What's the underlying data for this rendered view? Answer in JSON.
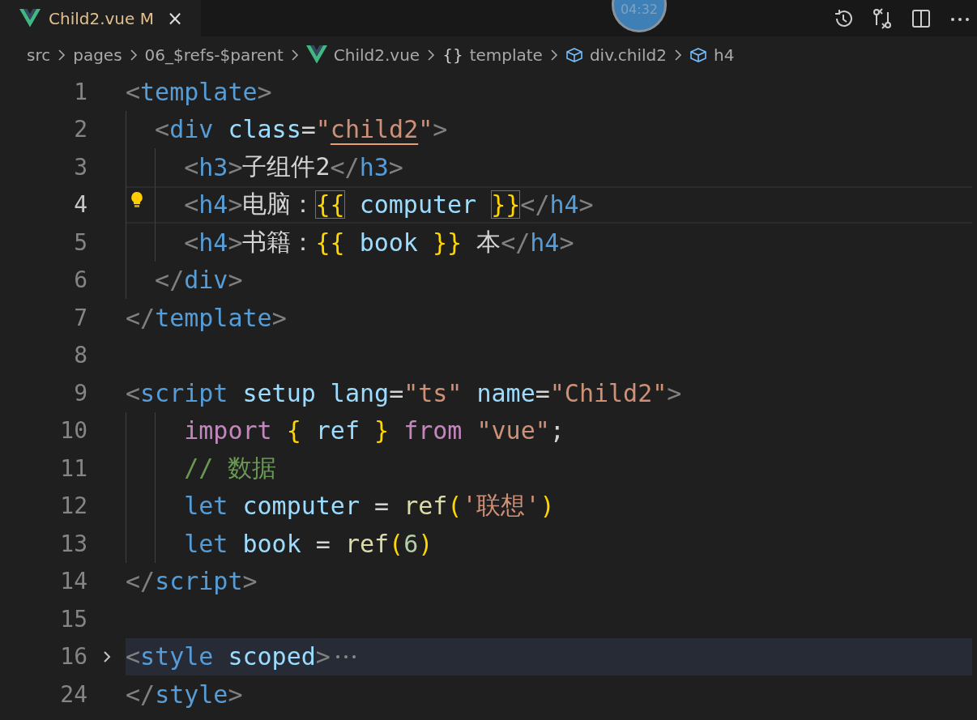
{
  "tab": {
    "title": "Child2.vue",
    "status": "M",
    "modified": true,
    "close": "×"
  },
  "timer": "04:32",
  "breadcrumbs": [
    {
      "label": "src",
      "kind": "folder"
    },
    {
      "label": "pages",
      "kind": "folder"
    },
    {
      "label": "06_$refs-$parent",
      "kind": "folder"
    },
    {
      "label": "Child2.vue",
      "kind": "file"
    },
    {
      "label": "template",
      "kind": "symbol",
      "glyph": "{}"
    },
    {
      "label": "div.child2",
      "kind": "element"
    },
    {
      "label": "h4",
      "kind": "element"
    }
  ],
  "lines": [
    {
      "number": "1",
      "current": false,
      "folded": false,
      "lightbulb": false,
      "tokens": [
        {
          "text": "<",
          "kind": "punct"
        },
        {
          "text": "template",
          "kind": "tag"
        },
        {
          "text": ">",
          "kind": "punct"
        }
      ]
    },
    {
      "number": "2",
      "current": false,
      "folded": false,
      "lightbulb": false,
      "tokens": [
        {
          "text": "  <",
          "kind": "punct"
        },
        {
          "text": "div",
          "kind": "tag"
        },
        {
          "text": " class",
          "kind": "attr"
        },
        {
          "text": "=",
          "kind": "text"
        },
        {
          "text": "\"",
          "kind": "str"
        },
        {
          "text": "child2",
          "kind": "warn"
        },
        {
          "text": "\"",
          "kind": "str"
        },
        {
          "text": ">",
          "kind": "punct"
        }
      ]
    },
    {
      "number": "3",
      "current": false,
      "folded": false,
      "lightbulb": false,
      "tokens": [
        {
          "text": "    <",
          "kind": "punct"
        },
        {
          "text": "h3",
          "kind": "tag"
        },
        {
          "text": ">",
          "kind": "punct"
        },
        {
          "text": "子组件2",
          "kind": "text"
        },
        {
          "text": "</",
          "kind": "punct"
        },
        {
          "text": "h3",
          "kind": "tag"
        },
        {
          "text": ">",
          "kind": "punct"
        }
      ]
    },
    {
      "number": "4",
      "current": true,
      "folded": false,
      "lightbulb": true,
      "tokens": [
        {
          "text": "    <",
          "kind": "punct"
        },
        {
          "text": "h4",
          "kind": "tag"
        },
        {
          "text": ">",
          "kind": "punct"
        },
        {
          "text": "电脑：",
          "kind": "text"
        },
        {
          "text": "{{",
          "kind": "match"
        },
        {
          "text": " computer ",
          "kind": "var"
        },
        {
          "text": "}}",
          "kind": "match"
        },
        {
          "text": "</",
          "kind": "punct"
        },
        {
          "text": "h4",
          "kind": "tag"
        },
        {
          "text": ">",
          "kind": "punct"
        }
      ]
    },
    {
      "number": "5",
      "current": false,
      "folded": false,
      "lightbulb": false,
      "tokens": [
        {
          "text": "    <",
          "kind": "punct"
        },
        {
          "text": "h4",
          "kind": "tag"
        },
        {
          "text": ">",
          "kind": "punct"
        },
        {
          "text": "书籍：",
          "kind": "text"
        },
        {
          "text": "{{",
          "kind": "brace"
        },
        {
          "text": " book ",
          "kind": "var"
        },
        {
          "text": "}}",
          "kind": "brace"
        },
        {
          "text": " 本",
          "kind": "text"
        },
        {
          "text": "</",
          "kind": "punct"
        },
        {
          "text": "h4",
          "kind": "tag"
        },
        {
          "text": ">",
          "kind": "punct"
        }
      ]
    },
    {
      "number": "6",
      "current": false,
      "folded": false,
      "lightbulb": false,
      "tokens": [
        {
          "text": "  </",
          "kind": "punct"
        },
        {
          "text": "div",
          "kind": "tag"
        },
        {
          "text": ">",
          "kind": "punct"
        }
      ]
    },
    {
      "number": "7",
      "current": false,
      "folded": false,
      "lightbulb": false,
      "tokens": [
        {
          "text": "</",
          "kind": "punct"
        },
        {
          "text": "template",
          "kind": "tag"
        },
        {
          "text": ">",
          "kind": "punct"
        }
      ]
    },
    {
      "number": "8",
      "current": false,
      "folded": false,
      "lightbulb": false
    },
    {
      "number": "9",
      "current": false,
      "folded": false,
      "lightbulb": false,
      "tokens": [
        {
          "text": "<",
          "kind": "punct"
        },
        {
          "text": "script",
          "kind": "tag"
        },
        {
          "text": " setup lang",
          "kind": "attr"
        },
        {
          "text": "=",
          "kind": "text"
        },
        {
          "text": "\"ts\"",
          "kind": "str"
        },
        {
          "text": " name",
          "kind": "attr"
        },
        {
          "text": "=",
          "kind": "text"
        },
        {
          "text": "\"Child2\"",
          "kind": "str"
        },
        {
          "text": ">",
          "kind": "punct"
        }
      ]
    },
    {
      "number": "10",
      "current": false,
      "folded": false,
      "lightbulb": false,
      "tokens": [
        {
          "text": "    import",
          "kind": "kw"
        },
        {
          "text": " {",
          "kind": "brace"
        },
        {
          "text": " ref",
          "kind": "var"
        },
        {
          "text": " }",
          "kind": "brace"
        },
        {
          "text": " from",
          "kind": "kw"
        },
        {
          "text": " \"vue\"",
          "kind": "str"
        },
        {
          "text": ";",
          "kind": "text"
        }
      ]
    },
    {
      "number": "11",
      "current": false,
      "folded": false,
      "lightbulb": false,
      "tokens": [
        {
          "text": "    // 数据",
          "kind": "comment"
        }
      ]
    },
    {
      "number": "12",
      "current": false,
      "folded": false,
      "lightbulb": false,
      "tokens": [
        {
          "text": "    let",
          "kind": "decl"
        },
        {
          "text": " computer",
          "kind": "var"
        },
        {
          "text": " = ",
          "kind": "text"
        },
        {
          "text": "ref",
          "kind": "fn"
        },
        {
          "text": "(",
          "kind": "brace"
        },
        {
          "text": "'联想'",
          "kind": "str"
        },
        {
          "text": ")",
          "kind": "brace"
        }
      ]
    },
    {
      "number": "13",
      "current": false,
      "folded": false,
      "lightbulb": false,
      "tokens": [
        {
          "text": "    let",
          "kind": "decl"
        },
        {
          "text": " book",
          "kind": "var"
        },
        {
          "text": " = ",
          "kind": "text"
        },
        {
          "text": "ref",
          "kind": "fn"
        },
        {
          "text": "(",
          "kind": "brace"
        },
        {
          "text": "6",
          "kind": "num"
        },
        {
          "text": ")",
          "kind": "brace"
        }
      ]
    },
    {
      "number": "14",
      "current": false,
      "folded": false,
      "lightbulb": false,
      "tokens": [
        {
          "text": "</",
          "kind": "punct"
        },
        {
          "text": "script",
          "kind": "tag"
        },
        {
          "text": ">",
          "kind": "punct"
        }
      ]
    },
    {
      "number": "15",
      "current": false,
      "folded": false,
      "lightbulb": false
    },
    {
      "number": "16",
      "current": false,
      "folded": true,
      "lightbulb": false,
      "tokens": [
        {
          "text": "<",
          "kind": "punct"
        },
        {
          "text": "style",
          "kind": "tag"
        },
        {
          "text": " scoped",
          "kind": "attr"
        },
        {
          "text": ">",
          "kind": "punct"
        }
      ]
    },
    {
      "number": "24",
      "current": false,
      "folded": false,
      "lightbulb": false,
      "tokens": [
        {
          "text": "</",
          "kind": "punct"
        },
        {
          "text": "style",
          "kind": "tag"
        },
        {
          "text": ">",
          "kind": "punct"
        }
      ]
    }
  ]
}
